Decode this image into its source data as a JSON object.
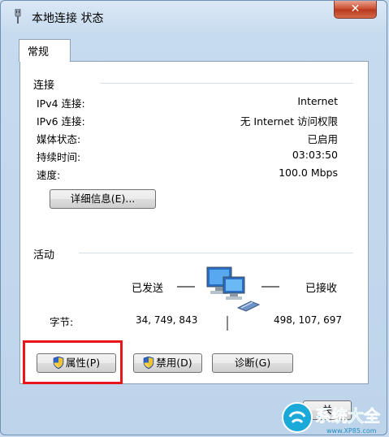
{
  "window": {
    "title": "本地连接 状态",
    "close": "✕"
  },
  "tab": {
    "label": "常规"
  },
  "connection": {
    "header": "连接",
    "rows": [
      {
        "label": "IPv4 连接:",
        "value": "Internet"
      },
      {
        "label": "IPv6 连接:",
        "value": "无 Internet 访问权限"
      },
      {
        "label": "媒体状态:",
        "value": "已启用"
      },
      {
        "label": "持续时间:",
        "value": "03:03:50"
      },
      {
        "label": "速度:",
        "value": "100.0 Mbps"
      }
    ],
    "details_button": "详细信息(E)..."
  },
  "activity": {
    "header": "活动",
    "sent_label": "已发送",
    "received_label": "已接收",
    "bytes_label": "字节:",
    "bytes_sent": "34, 749, 843",
    "bytes_received": "498, 107, 697"
  },
  "buttons": {
    "properties": "属性(P)",
    "disable": "禁用(D)",
    "diagnose": "诊断(G)",
    "close": "关"
  },
  "watermark": {
    "text": "系统大全",
    "url": "www.XP85.com"
  },
  "colors": {
    "highlight": "#e8151b",
    "close_button": "#c9482b"
  },
  "icons": [
    "network-adapter-icon",
    "network-computers-icon",
    "uac-shield-icon",
    "close-icon"
  ]
}
